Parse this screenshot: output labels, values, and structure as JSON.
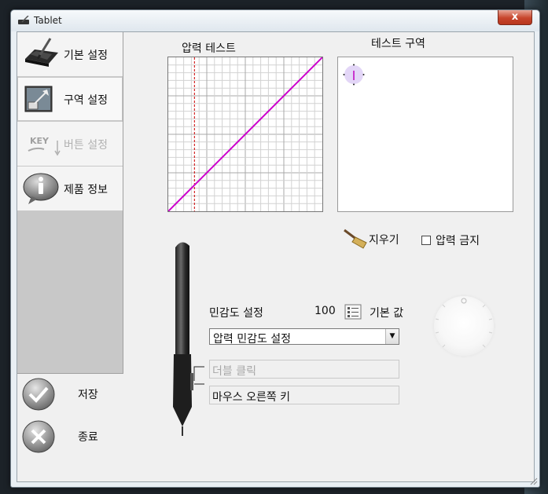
{
  "window": {
    "title": "Tablet",
    "close_glyph": "x"
  },
  "sidebar": {
    "items": [
      {
        "label": "기본 설정",
        "icon": "tablet-pen-icon",
        "disabled": false
      },
      {
        "label": "구역 설정",
        "icon": "area-mapping-icon",
        "disabled": false,
        "selected": true
      },
      {
        "label": "버튼 설정",
        "icon": "key-button-icon",
        "icon_text": "KEY",
        "disabled": true
      },
      {
        "label": "제품 정보",
        "icon": "info-bubble-icon",
        "disabled": false
      }
    ],
    "actions": [
      {
        "label": "저장",
        "icon": "checkmark-icon"
      },
      {
        "label": "종료",
        "icon": "close-x-icon"
      }
    ]
  },
  "pressure_test": {
    "label": "압력 테스트",
    "chart_data": {
      "type": "line",
      "xlim": [
        0,
        1
      ],
      "ylim": [
        0,
        1
      ],
      "grid": true,
      "series": [
        {
          "x": [
            0,
            1
          ],
          "y": [
            0,
            1
          ],
          "color": "#cc00cc"
        }
      ],
      "threshold_x": 0.17,
      "threshold_color": "#cc0000"
    }
  },
  "test_area": {
    "label": "테스트 구역"
  },
  "controls": {
    "erase_label": "지우기",
    "erase_icon": "broom-icon",
    "disable_pressure_label": "압력 금지",
    "disable_pressure_checked": false
  },
  "sensitivity": {
    "label": "민감도 설정",
    "value": "100",
    "default_icon": "checklist-icon",
    "default_label": "기본 값",
    "dropdown_value": "압력 민감도 설정",
    "dropdown_icon": "chevron-down-icon"
  },
  "pen_buttons": {
    "upper": "더블 클릭",
    "upper_disabled": true,
    "lower": "마우스 오른쪽 키"
  },
  "colors": {
    "accent_line": "#cc00cc",
    "threshold": "#cc0000",
    "titlebar_close": "#c7452c"
  }
}
